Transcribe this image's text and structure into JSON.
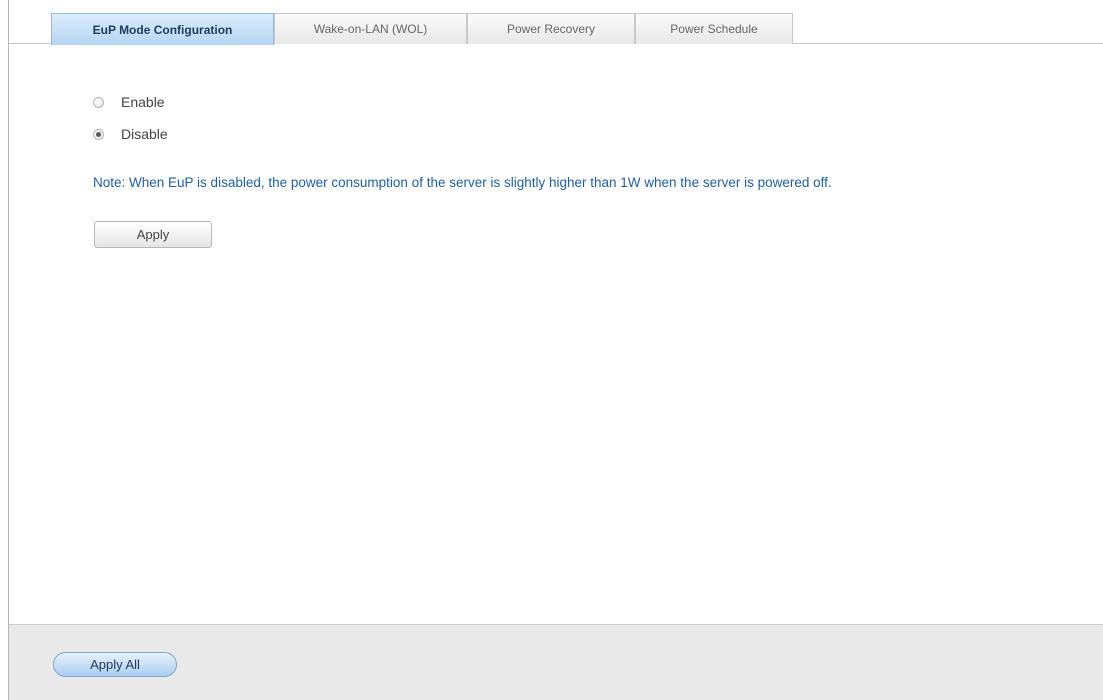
{
  "tabs": [
    {
      "label": "EuP Mode Configuration",
      "active": true
    },
    {
      "label": "Wake-on-LAN (WOL)",
      "active": false
    },
    {
      "label": "Power Recovery",
      "active": false
    },
    {
      "label": "Power Schedule",
      "active": false
    }
  ],
  "eup": {
    "options": [
      {
        "label": "Enable",
        "checked": false
      },
      {
        "label": "Disable",
        "checked": true
      }
    ],
    "note": "Note: When EuP is disabled, the power consumption of the server is slightly higher than 1W when the server is powered off.",
    "apply_label": "Apply"
  },
  "footer": {
    "apply_all_label": "Apply All"
  },
  "colors": {
    "accent": "#1f5f9e",
    "active_tab": "#b6d6f3",
    "footer_bg": "#e9e9e9"
  }
}
